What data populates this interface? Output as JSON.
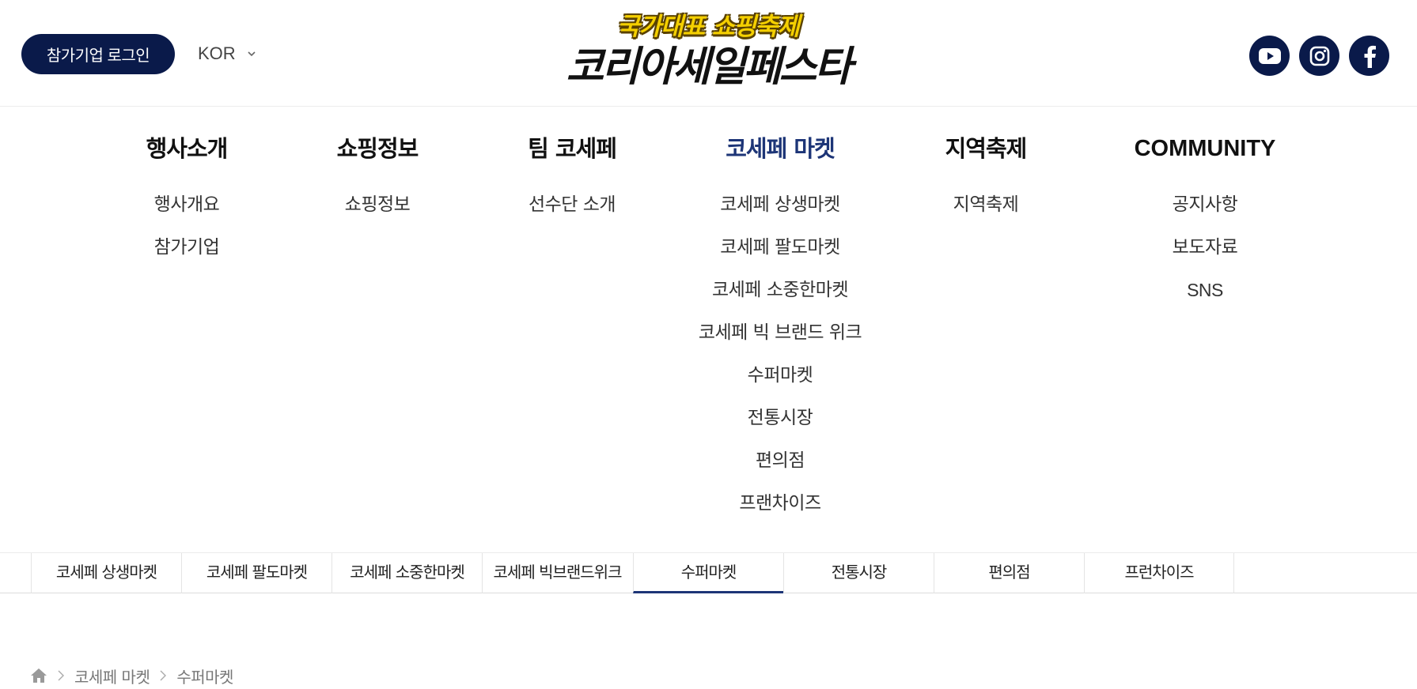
{
  "header": {
    "login_label": "참가기업 로그인",
    "language": "KOR",
    "logo_tagline": "국가대표 쇼핑축제",
    "logo_title": "코리아세일페스타",
    "social": [
      "youtube-icon",
      "instagram-icon",
      "facebook-icon"
    ]
  },
  "menu": [
    {
      "title": "행사소개",
      "items": [
        "행사개요",
        "참가기업"
      ]
    },
    {
      "title": "쇼핑정보",
      "items": [
        "쇼핑정보"
      ]
    },
    {
      "title": "팀 코세페",
      "items": [
        "선수단 소개"
      ]
    },
    {
      "title": "코세페 마켓",
      "items": [
        "코세페 상생마켓",
        "코세페 팔도마켓",
        "코세페 소중한마켓",
        "코세페 빅 브랜드 위크",
        "수퍼마켓",
        "전통시장",
        "편의점",
        "프랜차이즈"
      ]
    },
    {
      "title": "지역축제",
      "items": [
        "지역축제"
      ]
    },
    {
      "title": "COMMUNITY",
      "items": [
        "공지사항",
        "보도자료",
        "SNS"
      ]
    }
  ],
  "tabs": [
    "코세페 상생마켓",
    "코세페 팔도마켓",
    "코세페 소중한마켓",
    "코세페 빅브랜드위크",
    "수퍼마켓",
    "전통시장",
    "편의점",
    "프런차이즈"
  ],
  "active_tab": "수퍼마켓",
  "breadcrumb": [
    "코세페 마켓",
    "수퍼마켓"
  ],
  "colors": {
    "navy": "#0a1a4a",
    "active": "#1d3577",
    "logo_yellow": "#f5d000"
  }
}
